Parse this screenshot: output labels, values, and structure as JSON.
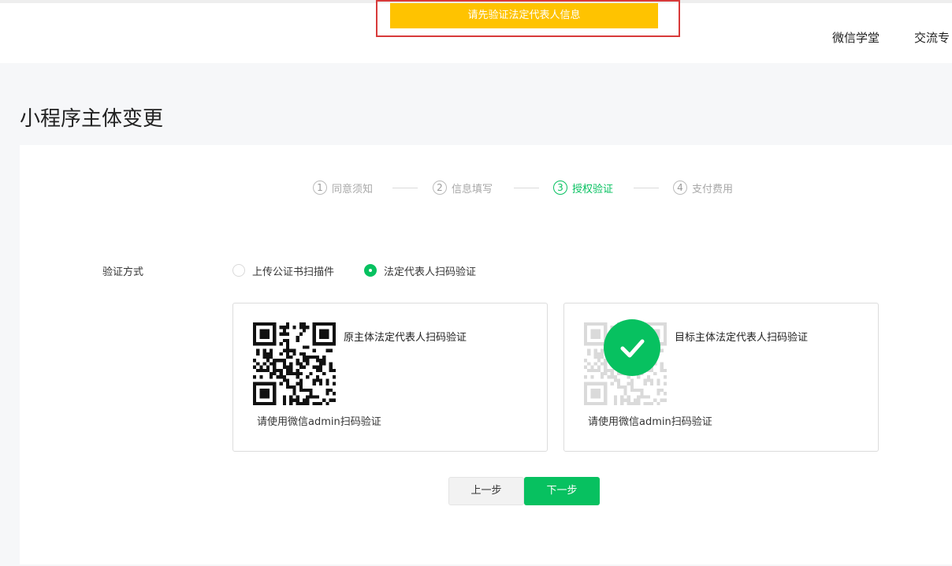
{
  "alert": {
    "text": "请先验证法定代表人信息"
  },
  "nav": {
    "items": [
      "微信学堂",
      "交流专"
    ]
  },
  "page": {
    "title": "小程序主体变更"
  },
  "steps": [
    {
      "num": "1",
      "label": "同意须知",
      "active": false
    },
    {
      "num": "2",
      "label": "信息填写",
      "active": false
    },
    {
      "num": "3",
      "label": "授权验证",
      "active": true
    },
    {
      "num": "4",
      "label": "支付费用",
      "active": false
    }
  ],
  "verify": {
    "label": "验证方式",
    "options": [
      {
        "label": "上传公证书扫描件",
        "checked": false
      },
      {
        "label": "法定代表人扫码验证",
        "checked": true
      }
    ]
  },
  "qr_boxes": [
    {
      "title": "原主体法定代表人扫码验证",
      "hint": "请使用微信admin扫码验证",
      "verified": false
    },
    {
      "title": "目标主体法定代表人扫码验证",
      "hint": "请使用微信admin扫码验证",
      "verified": true
    }
  ],
  "buttons": {
    "prev": "上一步",
    "next": "下一步"
  },
  "colors": {
    "accent": "#07c160",
    "alert": "#ffc300",
    "highlight_frame": "#d83a3a"
  },
  "icons": {
    "check": "check-icon",
    "qr": "qr-code-icon"
  }
}
